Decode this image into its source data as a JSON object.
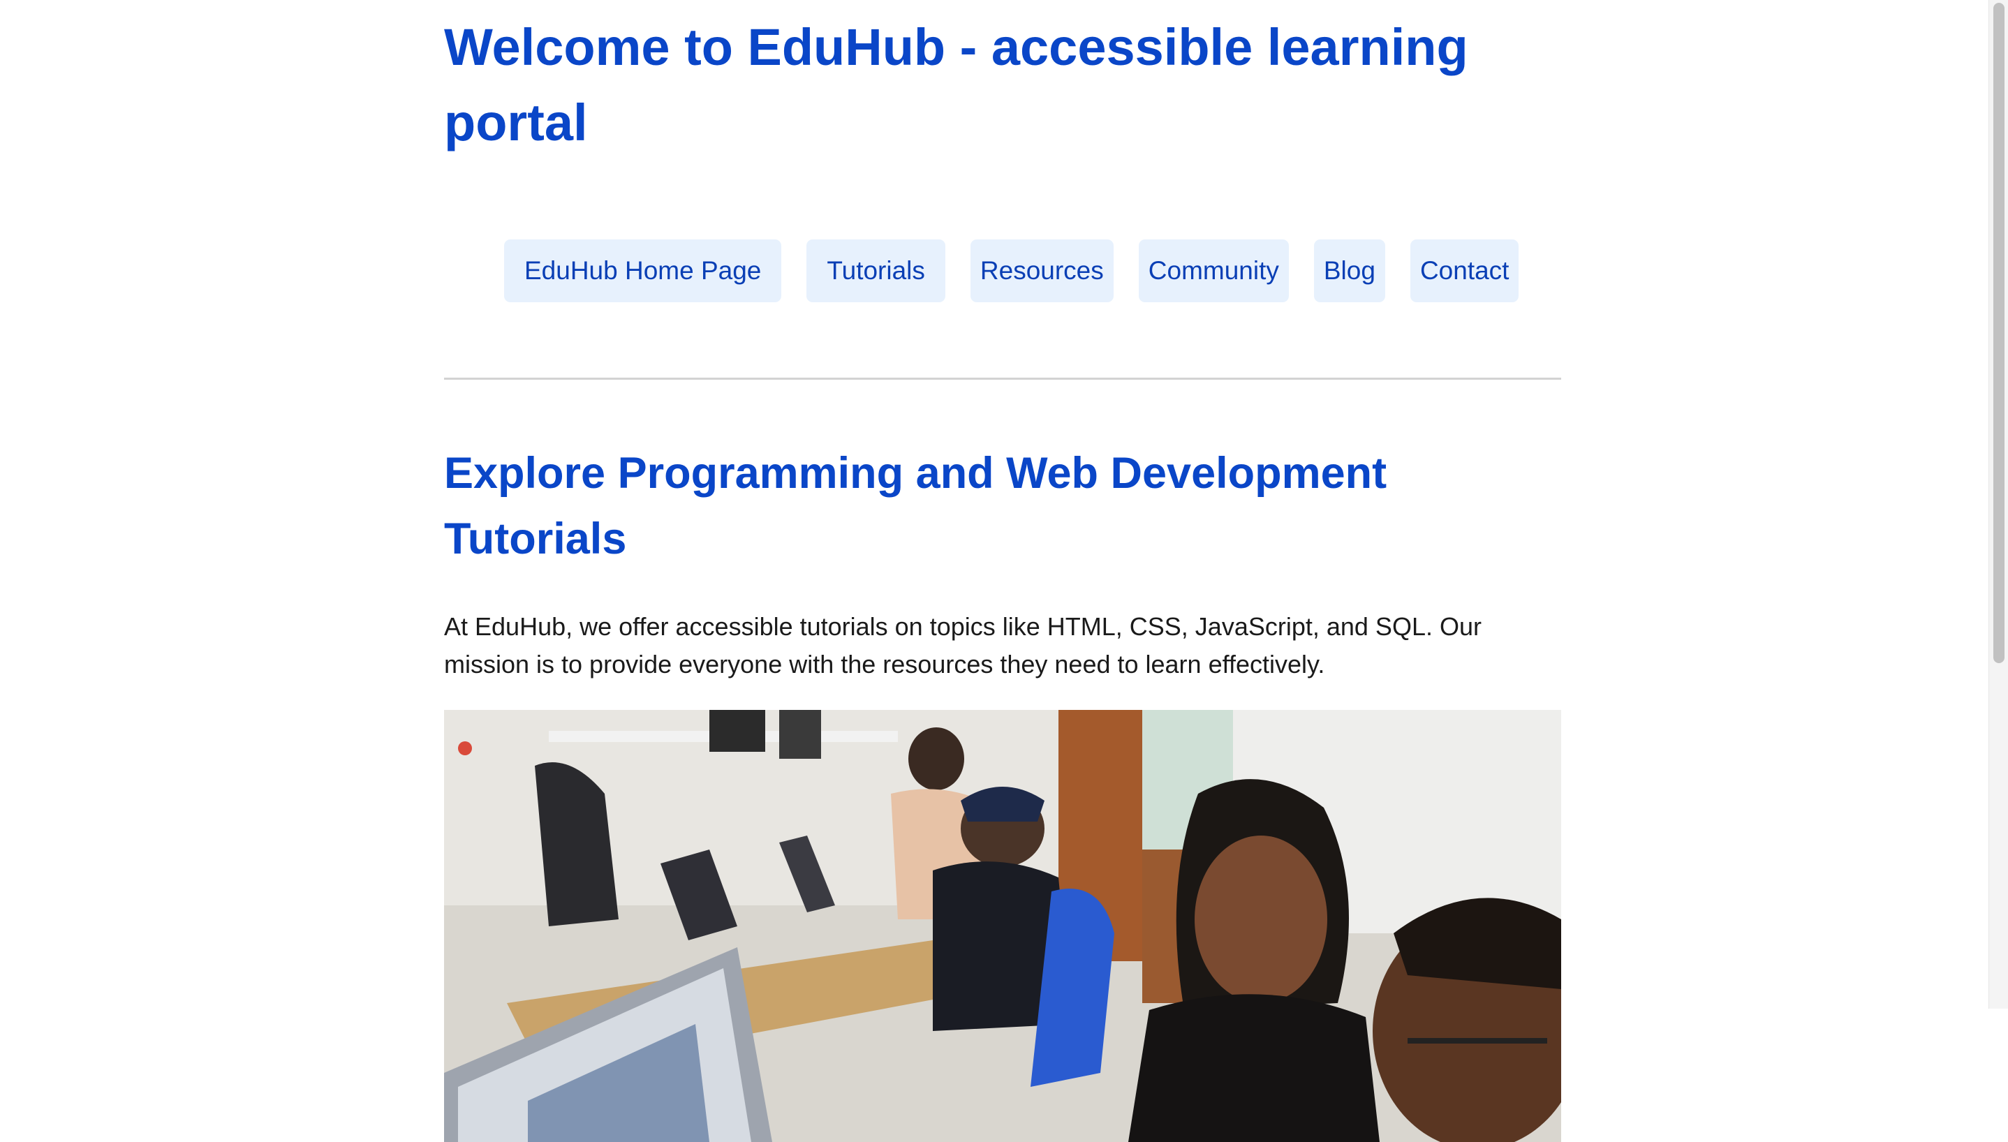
{
  "header": {
    "title": "Welcome to EduHub - accessible learning portal"
  },
  "nav": {
    "items": [
      {
        "label": "EduHub Home Page"
      },
      {
        "label": "Tutorials"
      },
      {
        "label": "Resources"
      },
      {
        "label": "Community"
      },
      {
        "label": "Blog"
      },
      {
        "label": "Contact"
      }
    ]
  },
  "main": {
    "heading": "Explore Programming and Web Development Tutorials",
    "intro": "At EduHub, we offer accessible tutorials on topics like HTML, CSS, JavaScript, and SQL. Our mission is to provide everyone with the resources they need to learn effectively."
  },
  "colors": {
    "heading": "#0a46c8",
    "nav_background": "#e7f1fd",
    "nav_text": "#0a3fb5",
    "body_text": "#1a1a1a"
  }
}
